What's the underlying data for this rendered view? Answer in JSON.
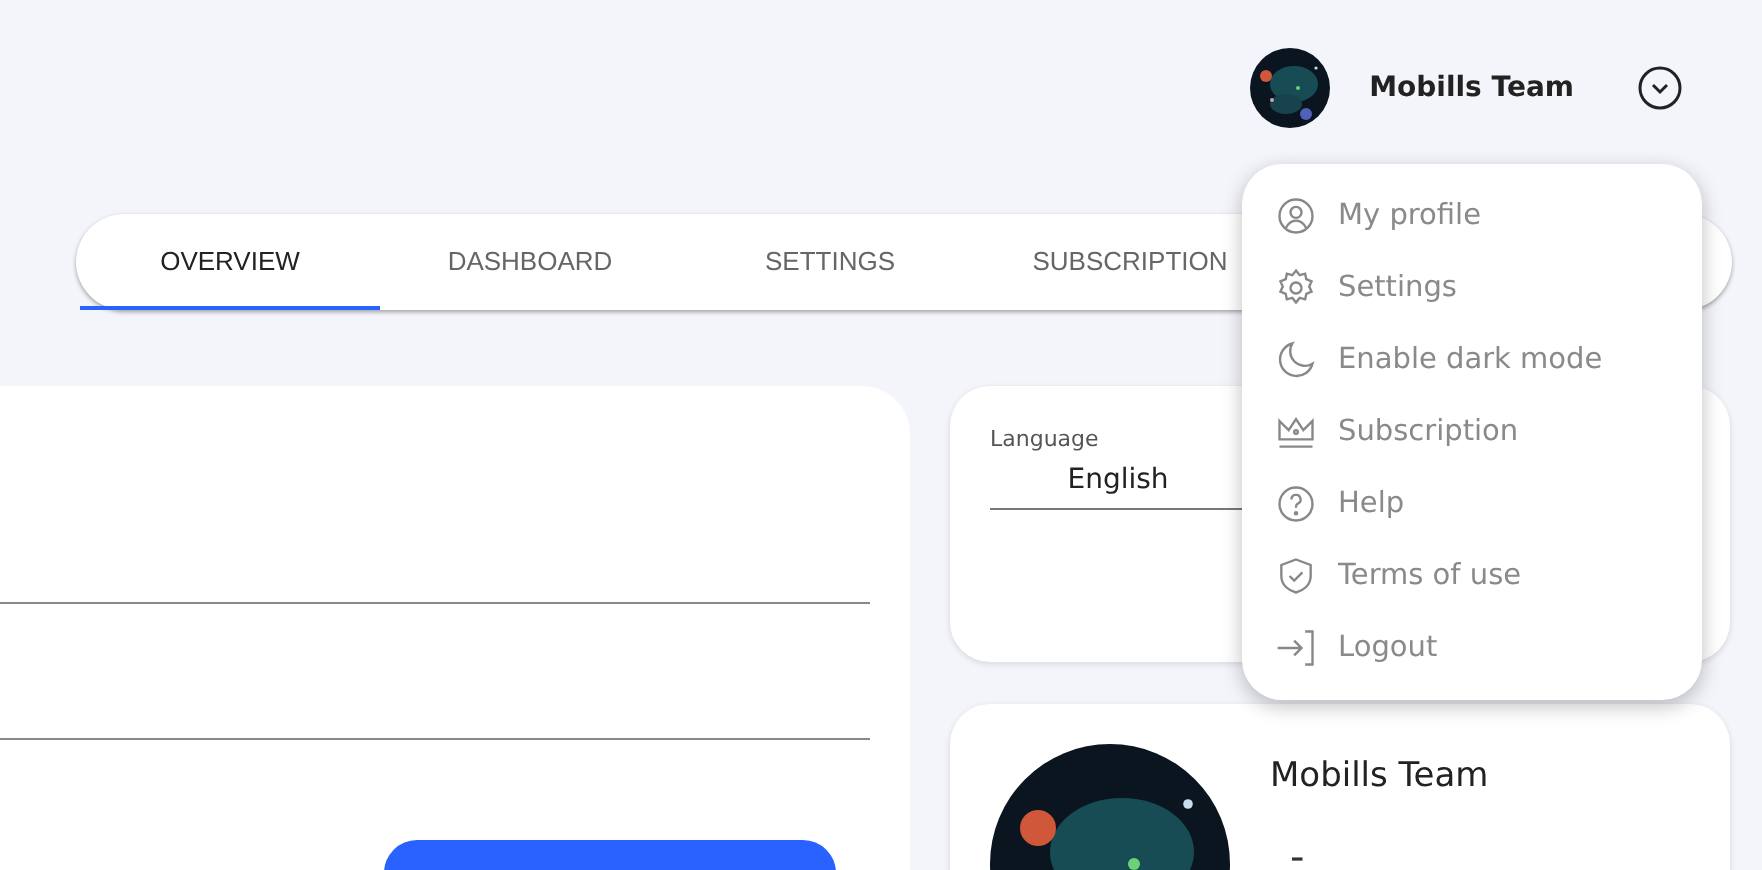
{
  "header": {
    "user_name": "Mobills Team",
    "menu_expanded": true
  },
  "tabs": [
    {
      "label": "OVERVIEW",
      "selected": true
    },
    {
      "label": "DASHBOARD",
      "selected": false
    },
    {
      "label": "SETTINGS",
      "selected": false
    },
    {
      "label": "SUBSCRIPTION",
      "selected": false
    }
  ],
  "settings_card": {
    "language_label": "Language",
    "language_value": "English"
  },
  "profile_card": {
    "name": "Mobills Team",
    "detail": "-"
  },
  "user_menu": [
    {
      "kind": "profile",
      "label": "My profile"
    },
    {
      "kind": "settings",
      "label": "Settings"
    },
    {
      "kind": "moon",
      "label": "Enable dark mode"
    },
    {
      "kind": "crown",
      "label": "Subscription"
    },
    {
      "kind": "help",
      "label": "Help"
    },
    {
      "kind": "shield",
      "label": "Terms of use"
    },
    {
      "kind": "logout",
      "label": "Logout"
    }
  ]
}
